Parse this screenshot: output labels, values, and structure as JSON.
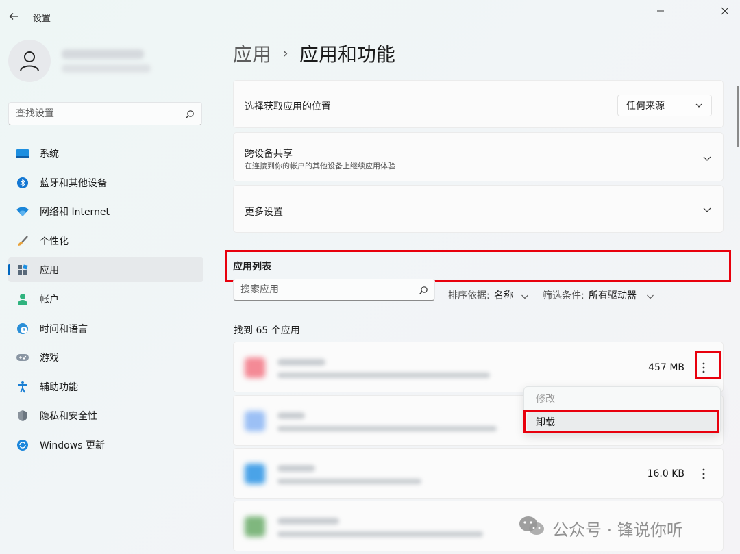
{
  "window": {
    "title": "设置"
  },
  "search": {
    "placeholder": "查找设置"
  },
  "nav": {
    "items": [
      {
        "label": "系统",
        "icon": "system-icon"
      },
      {
        "label": "蓝牙和其他设备",
        "icon": "bluetooth-icon"
      },
      {
        "label": "网络和 Internet",
        "icon": "wifi-icon"
      },
      {
        "label": "个性化",
        "icon": "brush-icon"
      },
      {
        "label": "应用",
        "icon": "apps-icon",
        "active": true
      },
      {
        "label": "帐户",
        "icon": "person-icon"
      },
      {
        "label": "时间和语言",
        "icon": "globe-clock-icon"
      },
      {
        "label": "游戏",
        "icon": "gamepad-icon"
      },
      {
        "label": "辅助功能",
        "icon": "accessibility-icon"
      },
      {
        "label": "隐私和安全性",
        "icon": "shield-icon"
      },
      {
        "label": "Windows 更新",
        "icon": "update-icon"
      }
    ]
  },
  "breadcrumb": {
    "parent": "应用",
    "separator": "›",
    "current": "应用和功能"
  },
  "cards": {
    "source": {
      "title": "选择获取应用的位置",
      "dropdown_value": "任何来源"
    },
    "share": {
      "title": "跨设备共享",
      "subtitle": "在连接到你的帐户的其他设备上继续应用体验"
    },
    "more": {
      "title": "更多设置"
    }
  },
  "app_list": {
    "title": "应用列表",
    "search_placeholder": "搜索应用",
    "sort_label": "排序依据:",
    "sort_value": "名称",
    "filter_label": "筛选条件:",
    "filter_value": "所有驱动器",
    "found_text": "找到 65 个应用",
    "rows": [
      {
        "size": "457 MB",
        "icon_color": "#f48a96"
      },
      {
        "size": "",
        "icon_color": "#9cc0f5"
      },
      {
        "size": "16.0 KB",
        "icon_color": "#4aa3e8"
      },
      {
        "size": "",
        "icon_color": "#7fb77e"
      }
    ]
  },
  "context_menu": {
    "modify": "修改",
    "uninstall": "卸载"
  },
  "watermark": {
    "text": "公众号 · 锋说你听"
  },
  "colors": {
    "accent": "#0067c0",
    "highlight": "#e8000d"
  }
}
